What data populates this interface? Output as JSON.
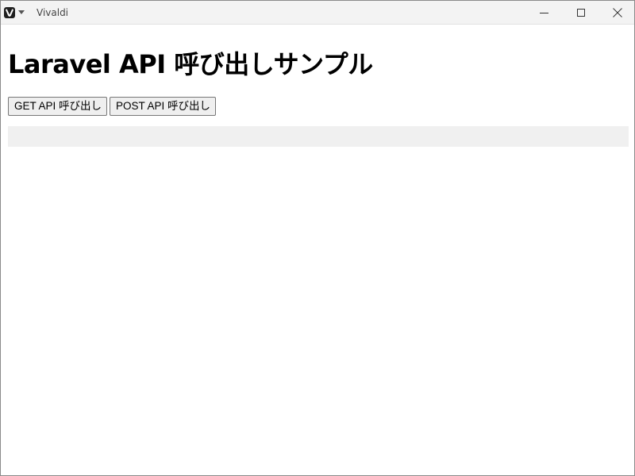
{
  "window": {
    "title": "Vivaldi"
  },
  "page": {
    "title": "Laravel API 呼び出しサンプル",
    "buttons": {
      "get_label": "GET API 呼び出し",
      "post_label": "POST API 呼び出し"
    },
    "result_text": ""
  },
  "icons": {
    "app": "vivaldi-logo-icon",
    "menu": "chevron-down-icon",
    "minimize": "minimize-icon",
    "maximize": "maximize-icon",
    "close": "close-icon"
  }
}
